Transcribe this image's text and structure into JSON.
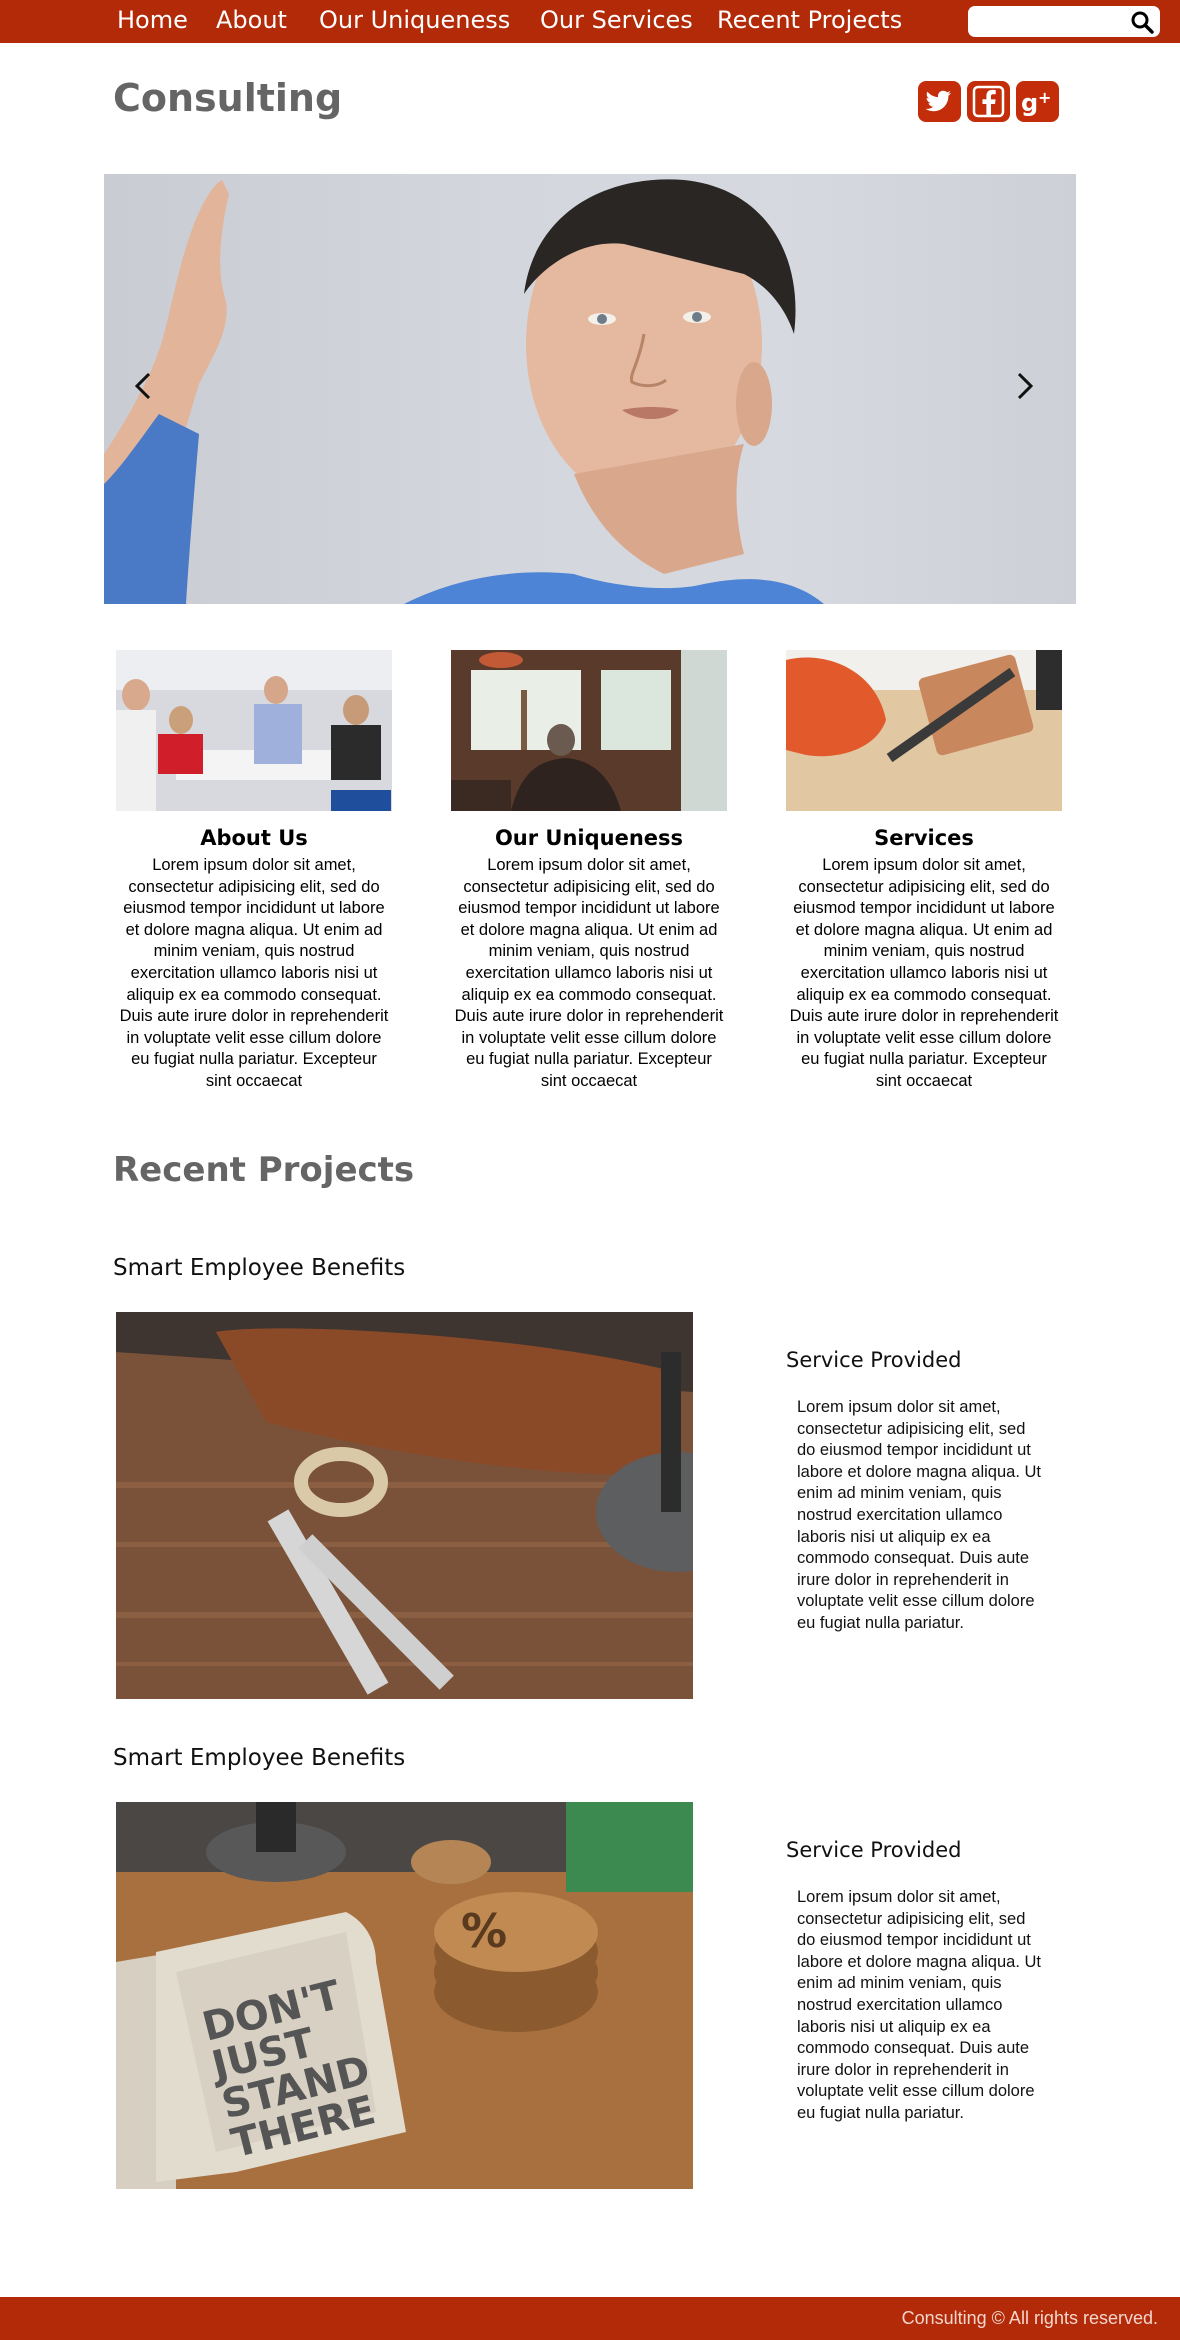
{
  "nav": {
    "items": [
      {
        "label": "Home"
      },
      {
        "label": "About"
      },
      {
        "label": "Our Uniqueness"
      },
      {
        "label": "Our Services"
      },
      {
        "label": "Recent Projects"
      }
    ],
    "search": {
      "placeholder": "",
      "icon": "search-icon"
    }
  },
  "header": {
    "title": "Consulting",
    "social": [
      {
        "icon": "twitter-icon"
      },
      {
        "icon": "facebook-icon"
      },
      {
        "icon": "google-plus-icon"
      }
    ]
  },
  "hero": {
    "prev_icon": "chevron-left-icon",
    "next_icon": "chevron-right-icon"
  },
  "features": [
    {
      "title": "About Us",
      "text": "Lorem ipsum dolor sit amet, consectetur adipisicing elit, sed do eiusmod tempor incididunt ut labore et dolore magna aliqua. Ut enim ad minim veniam, quis nostrud exercitation ullamco laboris nisi ut aliquip ex ea commodo consequat. Duis aute irure dolor in reprehenderit in voluptate velit esse cillum dolore eu fugiat nulla pariatur. Excepteur sint occaecat"
    },
    {
      "title": "Our Uniqueness",
      "text": "Lorem ipsum dolor sit amet, consectetur adipisicing elit, sed do eiusmod tempor incididunt ut labore et dolore magna aliqua. Ut enim ad minim veniam, quis nostrud exercitation ullamco laboris nisi ut aliquip ex ea commodo consequat. Duis aute irure dolor in reprehenderit in voluptate velit esse cillum dolore eu fugiat nulla pariatur. Excepteur sint occaecat"
    },
    {
      "title": "Services",
      "text": "Lorem ipsum dolor sit amet, consectetur adipisicing elit, sed do eiusmod tempor incididunt ut labore et dolore magna aliqua. Ut enim ad minim veniam, quis nostrud exercitation ullamco laboris nisi ut aliquip ex ea commodo consequat. Duis aute irure dolor in reprehenderit in voluptate velit esse cillum dolore eu fugiat nulla pariatur. Excepteur sint occaecat"
    }
  ],
  "recent": {
    "title": "Recent Projects",
    "projects": [
      {
        "title": "Smart Employee Benefits",
        "subtitle": "Service Provided",
        "text": "Lorem ipsum dolor sit amet, consectetur adipisicing elit, sed do eiusmod tempor incididunt ut labore et dolore magna aliqua. Ut enim ad minim veniam, quis nostrud exercitation ullamco laboris nisi ut aliquip ex ea commodo consequat. Duis aute irure dolor in reprehenderit in voluptate velit esse cillum dolore eu fugiat nulla pariatur."
      },
      {
        "title": "Smart Employee Benefits",
        "subtitle": "Service Provided",
        "text": "Lorem ipsum dolor sit amet, consectetur adipisicing elit, sed do eiusmod tempor incididunt ut labore et dolore magna aliqua. Ut enim ad minim veniam, quis nostrud exercitation ullamco laboris nisi ut aliquip ex ea commodo consequat. Duis aute irure dolor in reprehenderit in voluptate velit esse cillum dolore eu fugiat nulla pariatur."
      }
    ]
  },
  "footer": {
    "text": "Consulting © All rights reserved."
  },
  "colors": {
    "brand": "#b22a07",
    "social": "#c42d0a",
    "heading_gray": "#656565"
  }
}
